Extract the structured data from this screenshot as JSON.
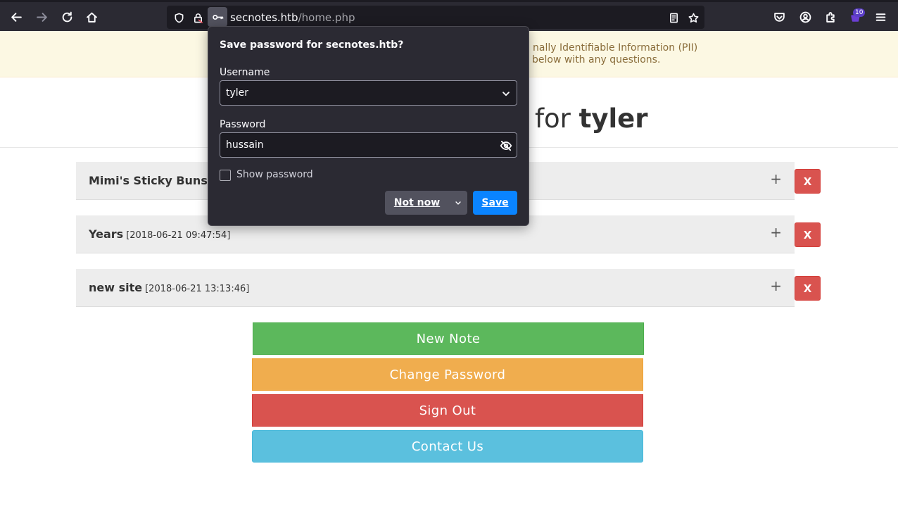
{
  "browser": {
    "url_host": "secnotes.htb",
    "url_path": "/home.php",
    "extensions_badge": "10"
  },
  "banner": {
    "line1": "nally Identifiable Information (PII)",
    "line2": "below with any questions."
  },
  "header": {
    "title_prefix": "for",
    "title_user": "tyler"
  },
  "notes": [
    {
      "title": "Mimi's Sticky Buns",
      "date": "[",
      "expand": "+",
      "delete": "X"
    },
    {
      "title": "Years",
      "date": "[2018-06-21 09:47:54]",
      "expand": "+",
      "delete": "X"
    },
    {
      "title": "new site",
      "date": "[2018-06-21 13:13:46]",
      "expand": "+",
      "delete": "X"
    }
  ],
  "actions": {
    "new_note": "New Note",
    "change_password": "Change Password",
    "sign_out": "Sign Out",
    "contact_us": "Contact Us"
  },
  "password_popup": {
    "title": "Save password for secnotes.htb?",
    "username_label": "Username",
    "username_value": "tyler",
    "password_label": "Password",
    "password_value": "hussain",
    "show_password_label": "Show password",
    "not_now_label": "Not now",
    "save_label": "Save"
  },
  "colors": {
    "success": "#5cb85c",
    "warning": "#f0ad4e",
    "danger": "#d9534f",
    "info": "#5bc0de",
    "popup_primary": "#0a84ff"
  }
}
